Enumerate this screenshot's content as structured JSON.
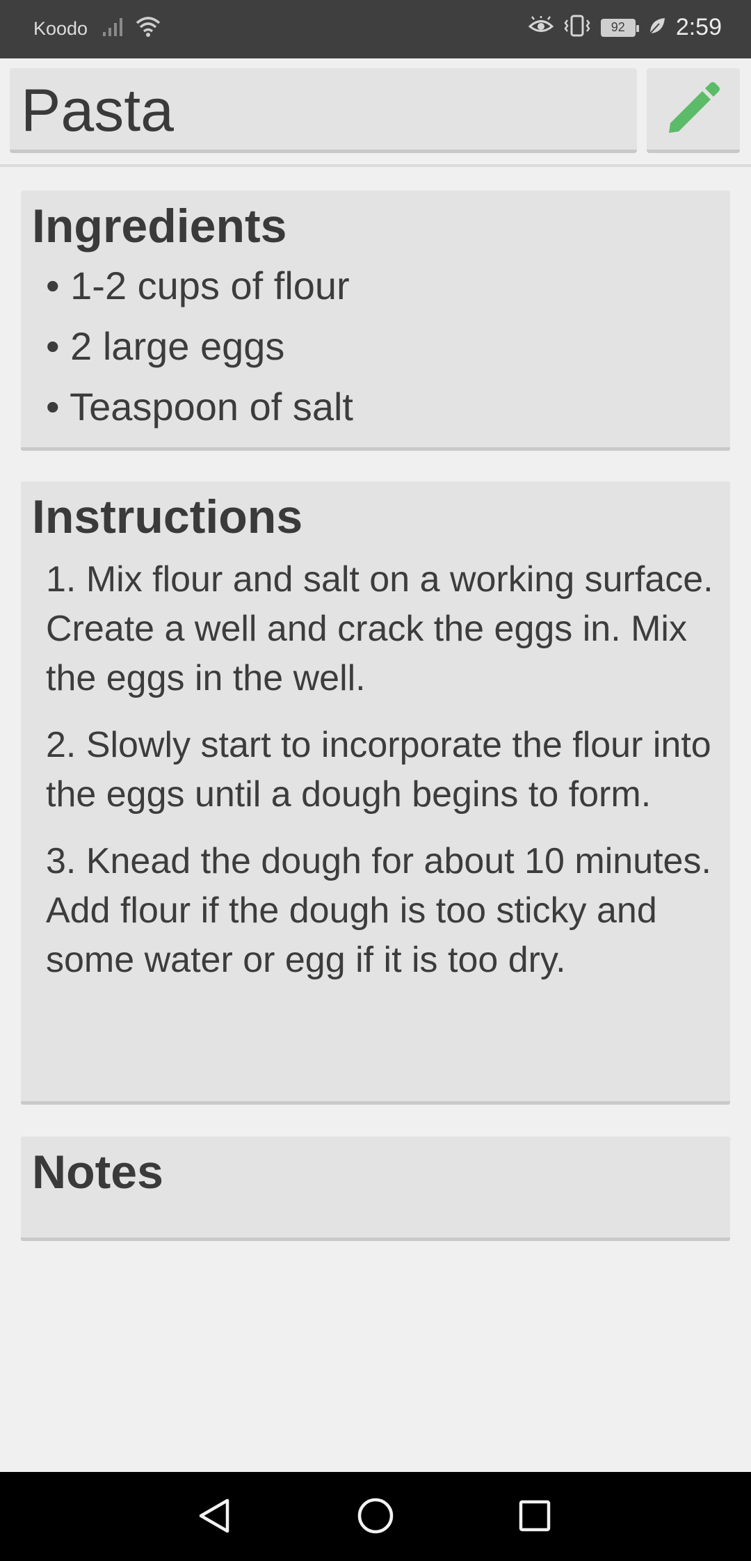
{
  "status_bar": {
    "carrier": "Koodo",
    "battery": "92",
    "time": "2:59",
    "icons": [
      "signal-icon",
      "wifi-icon",
      "eye-icon",
      "vibrate-icon",
      "battery-icon",
      "leaf-icon"
    ]
  },
  "header": {
    "title": "Pasta",
    "edit_icon": "pencil-icon",
    "accent_color": "#5cbb68"
  },
  "ingredients": {
    "heading": "Ingredients",
    "items": [
      "• 1-2 cups of flour",
      "• 2 large eggs",
      "• Teaspoon of salt"
    ]
  },
  "instructions": {
    "heading": "Instructions",
    "steps": [
      "1. Mix flour and salt on a working surface. Create a well and crack the eggs in. Mix the eggs in the well.",
      "2. Slowly start to incorporate the flour into the eggs until a dough begins to form.",
      "3. Knead the dough for about 10 minutes. Add flour if the dough is too sticky and some water or egg if it is too dry."
    ]
  },
  "notes": {
    "heading": "Notes",
    "body": ""
  },
  "nav_bar": {
    "icons": [
      "back-icon",
      "home-icon",
      "recents-icon"
    ]
  }
}
